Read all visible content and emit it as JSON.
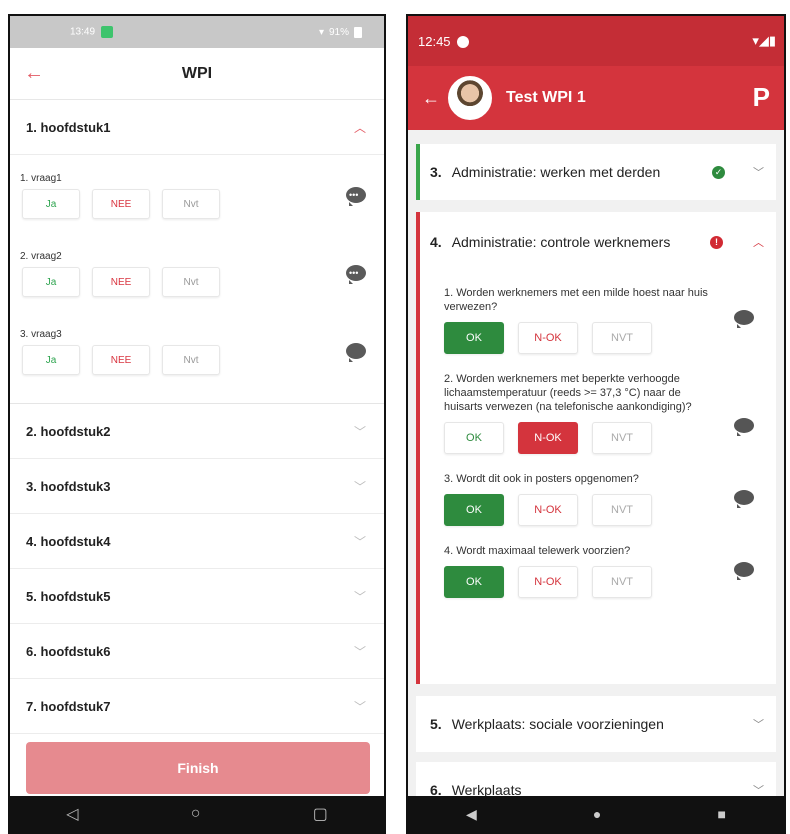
{
  "left": {
    "status": {
      "time": "13:49",
      "right": "91%"
    },
    "title": "WPI",
    "chapters": [
      {
        "label": "1. hoofdstuk1"
      },
      {
        "label": "2. hoofdstuk2"
      },
      {
        "label": "3. hoofdstuk3"
      },
      {
        "label": "4. hoofdstuk4"
      },
      {
        "label": "5. hoofdstuk5"
      },
      {
        "label": "6. hoofdstuk6"
      },
      {
        "label": "7. hoofdstuk7"
      }
    ],
    "questions": [
      {
        "label": "1. vraag1"
      },
      {
        "label": "2. vraag2"
      },
      {
        "label": "3. vraag3"
      }
    ],
    "answers": {
      "ja": "Ja",
      "nee": "NEE",
      "nvt": "Nvt"
    },
    "finish": "Finish",
    "nav": {
      "back": "◁",
      "home": "○",
      "recent": "▢"
    },
    "icons": {
      "back": "arrow-left-icon",
      "expand": "chevron-icon",
      "comment": "comment-icon"
    },
    "colors": {
      "accent": "#e35a64",
      "finish": "#e68a8f",
      "ja": "#2ea44f",
      "nee": "#d9343f"
    }
  },
  "right": {
    "status": {
      "time": "12:45"
    },
    "title": "Test WPI 1",
    "logo": "P",
    "sections": [
      {
        "num": "3.",
        "label": "Administratie: werken met derden",
        "state": "ok"
      },
      {
        "num": "4.",
        "label": "Administratie: controle werknemers",
        "state": "error"
      },
      {
        "num": "5.",
        "label": "Werkplaats: sociale voorzieningen"
      },
      {
        "num": "6.",
        "label": "Werkplaats"
      }
    ],
    "questions": [
      {
        "label": "1. Worden werknemers met een milde hoest naar huis verwezen?",
        "selected": "ok"
      },
      {
        "label": "2. Worden werknemers met beperkte verhoogde lichaamstemperatuur (reeds >= 37,3 °C) naar de huisarts verwezen (na telefonische aankondiging)?",
        "selected": "nok"
      },
      {
        "label": "3. Wordt dit ook in posters opgenomen?",
        "selected": "ok"
      },
      {
        "label": "4. Wordt maximaal telewerk voorzien?",
        "selected": "ok"
      }
    ],
    "answers": {
      "ok": "OK",
      "nok": "N-OK",
      "nvt": "NVT"
    },
    "nav": {
      "back": "◀",
      "home": "●",
      "recent": "■"
    },
    "colors": {
      "primary": "#d4343d",
      "ok": "#2e8b3e",
      "nok": "#d4343d"
    }
  }
}
